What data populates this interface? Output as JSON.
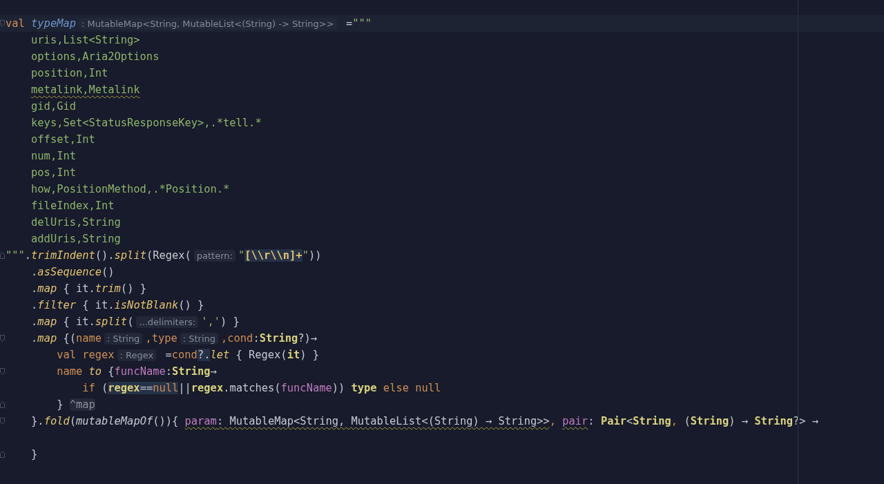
{
  "editor": {
    "lines": [
      {
        "current": true,
        "fold_start": true,
        "tokens": [
          {
            "kind": "keyword",
            "text": "val "
          },
          {
            "kind": "property",
            "text": "typeMap"
          },
          {
            "kind": "hint",
            "text": ": MutableMap<String, MutableList<(String) -> String>>"
          },
          {
            "kind": "plain",
            "text": " ="
          },
          {
            "kind": "string",
            "text": "\"\"\""
          }
        ]
      },
      {
        "tokens": [
          {
            "kind": "string",
            "text": "    uris,List<String>"
          }
        ]
      },
      {
        "tokens": [
          {
            "kind": "string",
            "text": "    options,Aria2Options"
          }
        ]
      },
      {
        "tokens": [
          {
            "kind": "string",
            "text": "    position,Int"
          }
        ]
      },
      {
        "tokens": [
          {
            "kind": "string",
            "text": "    metalink,Metalink",
            "warning": true
          }
        ]
      },
      {
        "tokens": [
          {
            "kind": "string",
            "text": "    gid,Gid"
          }
        ]
      },
      {
        "tokens": [
          {
            "kind": "string",
            "text": "    keys,Set<StatusResponseKey>,.*tell.*"
          }
        ]
      },
      {
        "tokens": [
          {
            "kind": "string",
            "text": "    offset,Int"
          }
        ]
      },
      {
        "tokens": [
          {
            "kind": "string",
            "text": "    num,Int"
          }
        ]
      },
      {
        "tokens": [
          {
            "kind": "string",
            "text": "    pos,Int"
          }
        ]
      },
      {
        "tokens": [
          {
            "kind": "string",
            "text": "    how,PositionMethod,.*Position.*"
          }
        ]
      },
      {
        "tokens": [
          {
            "kind": "string",
            "text": "    fileIndex,Int"
          }
        ]
      },
      {
        "tokens": [
          {
            "kind": "string",
            "text": "    delUris,String"
          }
        ]
      },
      {
        "tokens": [
          {
            "kind": "string",
            "text": "    addUris,String"
          }
        ]
      },
      {
        "fold_end": true,
        "tokens": [
          {
            "kind": "string",
            "text": "\"\"\""
          },
          {
            "kind": "plain",
            "text": "."
          },
          {
            "kind": "func",
            "text": "trimIndent"
          },
          {
            "kind": "plain",
            "text": "()."
          },
          {
            "kind": "func",
            "text": "split"
          },
          {
            "kind": "plain",
            "text": "(Regex("
          },
          {
            "kind": "hint",
            "text": "pattern:"
          },
          {
            "kind": "string",
            "text": "\""
          },
          {
            "kind": "escape",
            "text": "[\\\\r\\\\n]+",
            "highlighted": true
          },
          {
            "kind": "string",
            "text": "\""
          },
          {
            "kind": "plain",
            "text": "))"
          }
        ]
      },
      {
        "tokens": [
          {
            "kind": "plain",
            "text": "    ."
          },
          {
            "kind": "func",
            "text": "asSequence"
          },
          {
            "kind": "plain",
            "text": "()"
          }
        ]
      },
      {
        "tokens": [
          {
            "kind": "plain",
            "text": "    ."
          },
          {
            "kind": "func",
            "text": "map"
          },
          {
            "kind": "plain",
            "text": " { it."
          },
          {
            "kind": "func",
            "text": "trim"
          },
          {
            "kind": "plain",
            "text": "() }"
          }
        ]
      },
      {
        "tokens": [
          {
            "kind": "plain",
            "text": "    ."
          },
          {
            "kind": "func",
            "text": "filter"
          },
          {
            "kind": "plain",
            "text": " { it."
          },
          {
            "kind": "func",
            "text": "isNotBlank"
          },
          {
            "kind": "plain",
            "text": "() }"
          }
        ]
      },
      {
        "tokens": [
          {
            "kind": "plain",
            "text": "    ."
          },
          {
            "kind": "func",
            "text": "map"
          },
          {
            "kind": "plain",
            "text": " { it."
          },
          {
            "kind": "func",
            "text": "split"
          },
          {
            "kind": "plain",
            "text": "("
          },
          {
            "kind": "hint",
            "text": "...delimiters:"
          },
          {
            "kind": "string",
            "text": "','"
          },
          {
            "kind": "plain",
            "text": ") }"
          }
        ]
      },
      {
        "fold_start": true,
        "tokens": [
          {
            "kind": "plain",
            "text": "    ."
          },
          {
            "kind": "func",
            "text": "map"
          },
          {
            "kind": "plain",
            "text": " {("
          },
          {
            "kind": "variable",
            "text": "name"
          },
          {
            "kind": "hint",
            "text": ": String"
          },
          {
            "kind": "variable",
            "text": ",type"
          },
          {
            "kind": "hint",
            "text": ": String"
          },
          {
            "kind": "variable",
            "text": ",cond"
          },
          {
            "kind": "plain",
            "text": ":"
          },
          {
            "kind": "type",
            "text": "String"
          },
          {
            "kind": "plain",
            "text": "?)→"
          }
        ]
      },
      {
        "tokens": [
          {
            "kind": "keyword",
            "text": "        val "
          },
          {
            "kind": "variable",
            "text": "regex"
          },
          {
            "kind": "hint",
            "text": ": Regex"
          },
          {
            "kind": "plain",
            "text": " ="
          },
          {
            "kind": "variable",
            "text": "cond"
          },
          {
            "kind": "plain",
            "text": "?.",
            "highlighted": true
          },
          {
            "kind": "func",
            "text": "let"
          },
          {
            "kind": "plain",
            "text": " { Regex("
          },
          {
            "kind": "type",
            "text": "it"
          },
          {
            "kind": "plain",
            "text": ") }"
          }
        ]
      },
      {
        "fold_start": true,
        "tokens": [
          {
            "kind": "variable",
            "text": "        name "
          },
          {
            "kind": "func",
            "text": "to"
          },
          {
            "kind": "plain",
            "text": " {"
          },
          {
            "kind": "param",
            "text": "funcName"
          },
          {
            "kind": "plain",
            "text": ":"
          },
          {
            "kind": "type",
            "text": "String"
          },
          {
            "kind": "plain",
            "text": "→"
          }
        ]
      },
      {
        "tokens": [
          {
            "kind": "keyword",
            "text": "            if "
          },
          {
            "kind": "plain",
            "text": "("
          },
          {
            "kind": "type",
            "text": "regex",
            "highlighted": true
          },
          {
            "kind": "plain",
            "text": "==",
            "highlighted": true
          },
          {
            "kind": "keyword",
            "text": "null",
            "highlighted": true
          },
          {
            "kind": "plain",
            "text": "||"
          },
          {
            "kind": "type",
            "text": "regex"
          },
          {
            "kind": "plain",
            "text": ".matches("
          },
          {
            "kind": "param",
            "text": "funcName"
          },
          {
            "kind": "plain",
            "text": ")) "
          },
          {
            "kind": "type",
            "text": "type"
          },
          {
            "kind": "keyword",
            "text": " else null"
          }
        ]
      },
      {
        "fold_end": true,
        "tokens": [
          {
            "kind": "plain",
            "text": "        } "
          },
          {
            "kind": "label",
            "text": "^map"
          }
        ]
      },
      {
        "fold_start": true,
        "tokens": [
          {
            "kind": "plain",
            "text": "    }."
          },
          {
            "kind": "func",
            "text": "fold"
          },
          {
            "kind": "plain",
            "text": "("
          },
          {
            "kind": "call",
            "text": "mutableMapOf"
          },
          {
            "kind": "plain",
            "text": "()){ "
          },
          {
            "kind": "param",
            "text": "param",
            "warning": true
          },
          {
            "kind": "plain",
            "text": ": MutableMap<String, MutableList<(String) → String>>",
            "warning": true
          },
          {
            "kind": "variable",
            "text": ", "
          },
          {
            "kind": "param",
            "text": "pair",
            "warning": true
          },
          {
            "kind": "plain",
            "text": ": "
          },
          {
            "kind": "type",
            "text": "Pair"
          },
          {
            "kind": "plain",
            "text": "<"
          },
          {
            "kind": "type",
            "text": "String"
          },
          {
            "kind": "variable",
            "text": ", "
          },
          {
            "kind": "plain",
            "text": "("
          },
          {
            "kind": "type",
            "text": "String"
          },
          {
            "kind": "plain",
            "text": ") → "
          },
          {
            "kind": "type",
            "text": "String"
          },
          {
            "kind": "plain",
            "text": "?> →"
          }
        ]
      },
      {
        "fold_end": true,
        "blank_before": true,
        "tokens": [
          {
            "kind": "plain",
            "text": "    }"
          }
        ]
      }
    ]
  }
}
